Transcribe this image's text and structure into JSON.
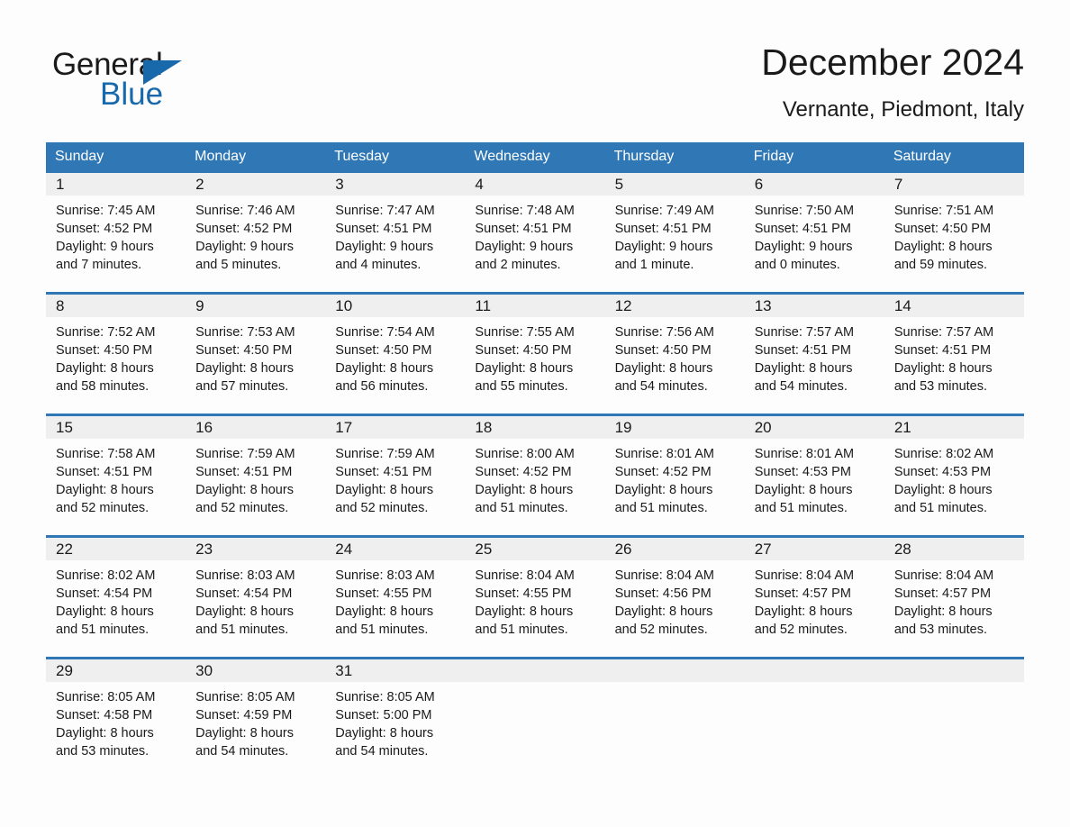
{
  "brand": {
    "name_part1": "General",
    "name_part2": "Blue",
    "triangle_color": "#1769ab",
    "blue_color": "#1769ab"
  },
  "header": {
    "month_title": "December 2024",
    "location": "Vernante, Piedmont, Italy"
  },
  "theme": {
    "header_bg": "#3077b5",
    "header_text": "#ffffff",
    "daynum_band_bg": "#efefef",
    "page_bg": "#fdfdfd",
    "text": "#1a1a1a"
  },
  "weekdays": [
    "Sunday",
    "Monday",
    "Tuesday",
    "Wednesday",
    "Thursday",
    "Friday",
    "Saturday"
  ],
  "weeks": [
    [
      {
        "day": "1",
        "sunrise": "Sunrise: 7:45 AM",
        "sunset": "Sunset: 4:52 PM",
        "daylight_line1": "Daylight: 9 hours",
        "daylight_line2": "and 7 minutes."
      },
      {
        "day": "2",
        "sunrise": "Sunrise: 7:46 AM",
        "sunset": "Sunset: 4:52 PM",
        "daylight_line1": "Daylight: 9 hours",
        "daylight_line2": "and 5 minutes."
      },
      {
        "day": "3",
        "sunrise": "Sunrise: 7:47 AM",
        "sunset": "Sunset: 4:51 PM",
        "daylight_line1": "Daylight: 9 hours",
        "daylight_line2": "and 4 minutes."
      },
      {
        "day": "4",
        "sunrise": "Sunrise: 7:48 AM",
        "sunset": "Sunset: 4:51 PM",
        "daylight_line1": "Daylight: 9 hours",
        "daylight_line2": "and 2 minutes."
      },
      {
        "day": "5",
        "sunrise": "Sunrise: 7:49 AM",
        "sunset": "Sunset: 4:51 PM",
        "daylight_line1": "Daylight: 9 hours",
        "daylight_line2": "and 1 minute."
      },
      {
        "day": "6",
        "sunrise": "Sunrise: 7:50 AM",
        "sunset": "Sunset: 4:51 PM",
        "daylight_line1": "Daylight: 9 hours",
        "daylight_line2": "and 0 minutes."
      },
      {
        "day": "7",
        "sunrise": "Sunrise: 7:51 AM",
        "sunset": "Sunset: 4:50 PM",
        "daylight_line1": "Daylight: 8 hours",
        "daylight_line2": "and 59 minutes."
      }
    ],
    [
      {
        "day": "8",
        "sunrise": "Sunrise: 7:52 AM",
        "sunset": "Sunset: 4:50 PM",
        "daylight_line1": "Daylight: 8 hours",
        "daylight_line2": "and 58 minutes."
      },
      {
        "day": "9",
        "sunrise": "Sunrise: 7:53 AM",
        "sunset": "Sunset: 4:50 PM",
        "daylight_line1": "Daylight: 8 hours",
        "daylight_line2": "and 57 minutes."
      },
      {
        "day": "10",
        "sunrise": "Sunrise: 7:54 AM",
        "sunset": "Sunset: 4:50 PM",
        "daylight_line1": "Daylight: 8 hours",
        "daylight_line2": "and 56 minutes."
      },
      {
        "day": "11",
        "sunrise": "Sunrise: 7:55 AM",
        "sunset": "Sunset: 4:50 PM",
        "daylight_line1": "Daylight: 8 hours",
        "daylight_line2": "and 55 minutes."
      },
      {
        "day": "12",
        "sunrise": "Sunrise: 7:56 AM",
        "sunset": "Sunset: 4:50 PM",
        "daylight_line1": "Daylight: 8 hours",
        "daylight_line2": "and 54 minutes."
      },
      {
        "day": "13",
        "sunrise": "Sunrise: 7:57 AM",
        "sunset": "Sunset: 4:51 PM",
        "daylight_line1": "Daylight: 8 hours",
        "daylight_line2": "and 54 minutes."
      },
      {
        "day": "14",
        "sunrise": "Sunrise: 7:57 AM",
        "sunset": "Sunset: 4:51 PM",
        "daylight_line1": "Daylight: 8 hours",
        "daylight_line2": "and 53 minutes."
      }
    ],
    [
      {
        "day": "15",
        "sunrise": "Sunrise: 7:58 AM",
        "sunset": "Sunset: 4:51 PM",
        "daylight_line1": "Daylight: 8 hours",
        "daylight_line2": "and 52 minutes."
      },
      {
        "day": "16",
        "sunrise": "Sunrise: 7:59 AM",
        "sunset": "Sunset: 4:51 PM",
        "daylight_line1": "Daylight: 8 hours",
        "daylight_line2": "and 52 minutes."
      },
      {
        "day": "17",
        "sunrise": "Sunrise: 7:59 AM",
        "sunset": "Sunset: 4:51 PM",
        "daylight_line1": "Daylight: 8 hours",
        "daylight_line2": "and 52 minutes."
      },
      {
        "day": "18",
        "sunrise": "Sunrise: 8:00 AM",
        "sunset": "Sunset: 4:52 PM",
        "daylight_line1": "Daylight: 8 hours",
        "daylight_line2": "and 51 minutes."
      },
      {
        "day": "19",
        "sunrise": "Sunrise: 8:01 AM",
        "sunset": "Sunset: 4:52 PM",
        "daylight_line1": "Daylight: 8 hours",
        "daylight_line2": "and 51 minutes."
      },
      {
        "day": "20",
        "sunrise": "Sunrise: 8:01 AM",
        "sunset": "Sunset: 4:53 PM",
        "daylight_line1": "Daylight: 8 hours",
        "daylight_line2": "and 51 minutes."
      },
      {
        "day": "21",
        "sunrise": "Sunrise: 8:02 AM",
        "sunset": "Sunset: 4:53 PM",
        "daylight_line1": "Daylight: 8 hours",
        "daylight_line2": "and 51 minutes."
      }
    ],
    [
      {
        "day": "22",
        "sunrise": "Sunrise: 8:02 AM",
        "sunset": "Sunset: 4:54 PM",
        "daylight_line1": "Daylight: 8 hours",
        "daylight_line2": "and 51 minutes."
      },
      {
        "day": "23",
        "sunrise": "Sunrise: 8:03 AM",
        "sunset": "Sunset: 4:54 PM",
        "daylight_line1": "Daylight: 8 hours",
        "daylight_line2": "and 51 minutes."
      },
      {
        "day": "24",
        "sunrise": "Sunrise: 8:03 AM",
        "sunset": "Sunset: 4:55 PM",
        "daylight_line1": "Daylight: 8 hours",
        "daylight_line2": "and 51 minutes."
      },
      {
        "day": "25",
        "sunrise": "Sunrise: 8:04 AM",
        "sunset": "Sunset: 4:55 PM",
        "daylight_line1": "Daylight: 8 hours",
        "daylight_line2": "and 51 minutes."
      },
      {
        "day": "26",
        "sunrise": "Sunrise: 8:04 AM",
        "sunset": "Sunset: 4:56 PM",
        "daylight_line1": "Daylight: 8 hours",
        "daylight_line2": "and 52 minutes."
      },
      {
        "day": "27",
        "sunrise": "Sunrise: 8:04 AM",
        "sunset": "Sunset: 4:57 PM",
        "daylight_line1": "Daylight: 8 hours",
        "daylight_line2": "and 52 minutes."
      },
      {
        "day": "28",
        "sunrise": "Sunrise: 8:04 AM",
        "sunset": "Sunset: 4:57 PM",
        "daylight_line1": "Daylight: 8 hours",
        "daylight_line2": "and 53 minutes."
      }
    ],
    [
      {
        "day": "29",
        "sunrise": "Sunrise: 8:05 AM",
        "sunset": "Sunset: 4:58 PM",
        "daylight_line1": "Daylight: 8 hours",
        "daylight_line2": "and 53 minutes."
      },
      {
        "day": "30",
        "sunrise": "Sunrise: 8:05 AM",
        "sunset": "Sunset: 4:59 PM",
        "daylight_line1": "Daylight: 8 hours",
        "daylight_line2": "and 54 minutes."
      },
      {
        "day": "31",
        "sunrise": "Sunrise: 8:05 AM",
        "sunset": "Sunset: 5:00 PM",
        "daylight_line1": "Daylight: 8 hours",
        "daylight_line2": "and 54 minutes."
      },
      {
        "day": "",
        "sunrise": "",
        "sunset": "",
        "daylight_line1": "",
        "daylight_line2": ""
      },
      {
        "day": "",
        "sunrise": "",
        "sunset": "",
        "daylight_line1": "",
        "daylight_line2": ""
      },
      {
        "day": "",
        "sunrise": "",
        "sunset": "",
        "daylight_line1": "",
        "daylight_line2": ""
      },
      {
        "day": "",
        "sunrise": "",
        "sunset": "",
        "daylight_line1": "",
        "daylight_line2": ""
      }
    ]
  ]
}
